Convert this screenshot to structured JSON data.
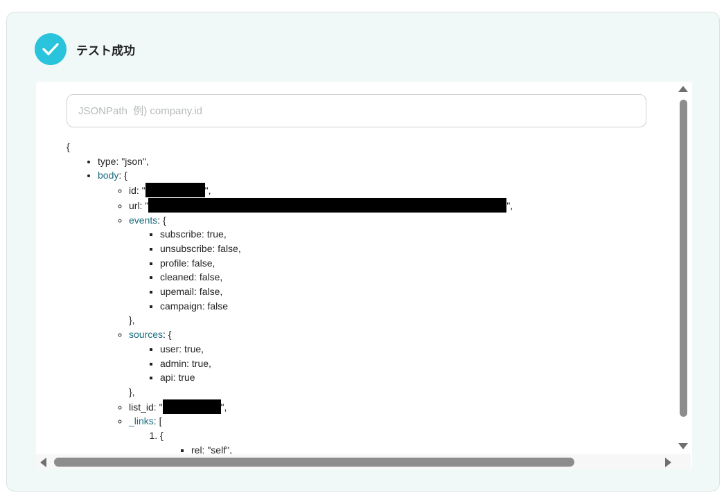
{
  "header": {
    "icon": "check-circle-icon",
    "accent": "#29c3dc",
    "title": "テスト成功"
  },
  "search": {
    "placeholder": "JSONPath  例) company.id",
    "value": ""
  },
  "tree": {
    "open_brace": "{",
    "type_line": "type: \"json\",",
    "body_key": "body",
    "body_suffix": ": {",
    "id_prefix": "id: \"",
    "id_suffix": "\",",
    "url_prefix": "url: \"",
    "url_suffix": "\",",
    "events_key": "events",
    "events_suffix": ": {",
    "events": [
      "subscribe: true,",
      "unsubscribe: false,",
      "profile: false,",
      "cleaned: false,",
      "upemail: false,",
      "campaign: false"
    ],
    "events_close": "},",
    "sources_key": "sources",
    "sources_suffix": ": {",
    "sources": [
      "user: true,",
      "admin: true,",
      "api: true"
    ],
    "sources_close": "},",
    "list_id_prefix": "list_id: \"",
    "list_id_suffix": "\",",
    "links_key": "_links",
    "links_suffix": ": [",
    "links_item_open": "{",
    "rel_line": "rel: \"self\","
  },
  "colors": {
    "link_key": "#1a6c7f",
    "card_bg": "#f1f8f8"
  }
}
